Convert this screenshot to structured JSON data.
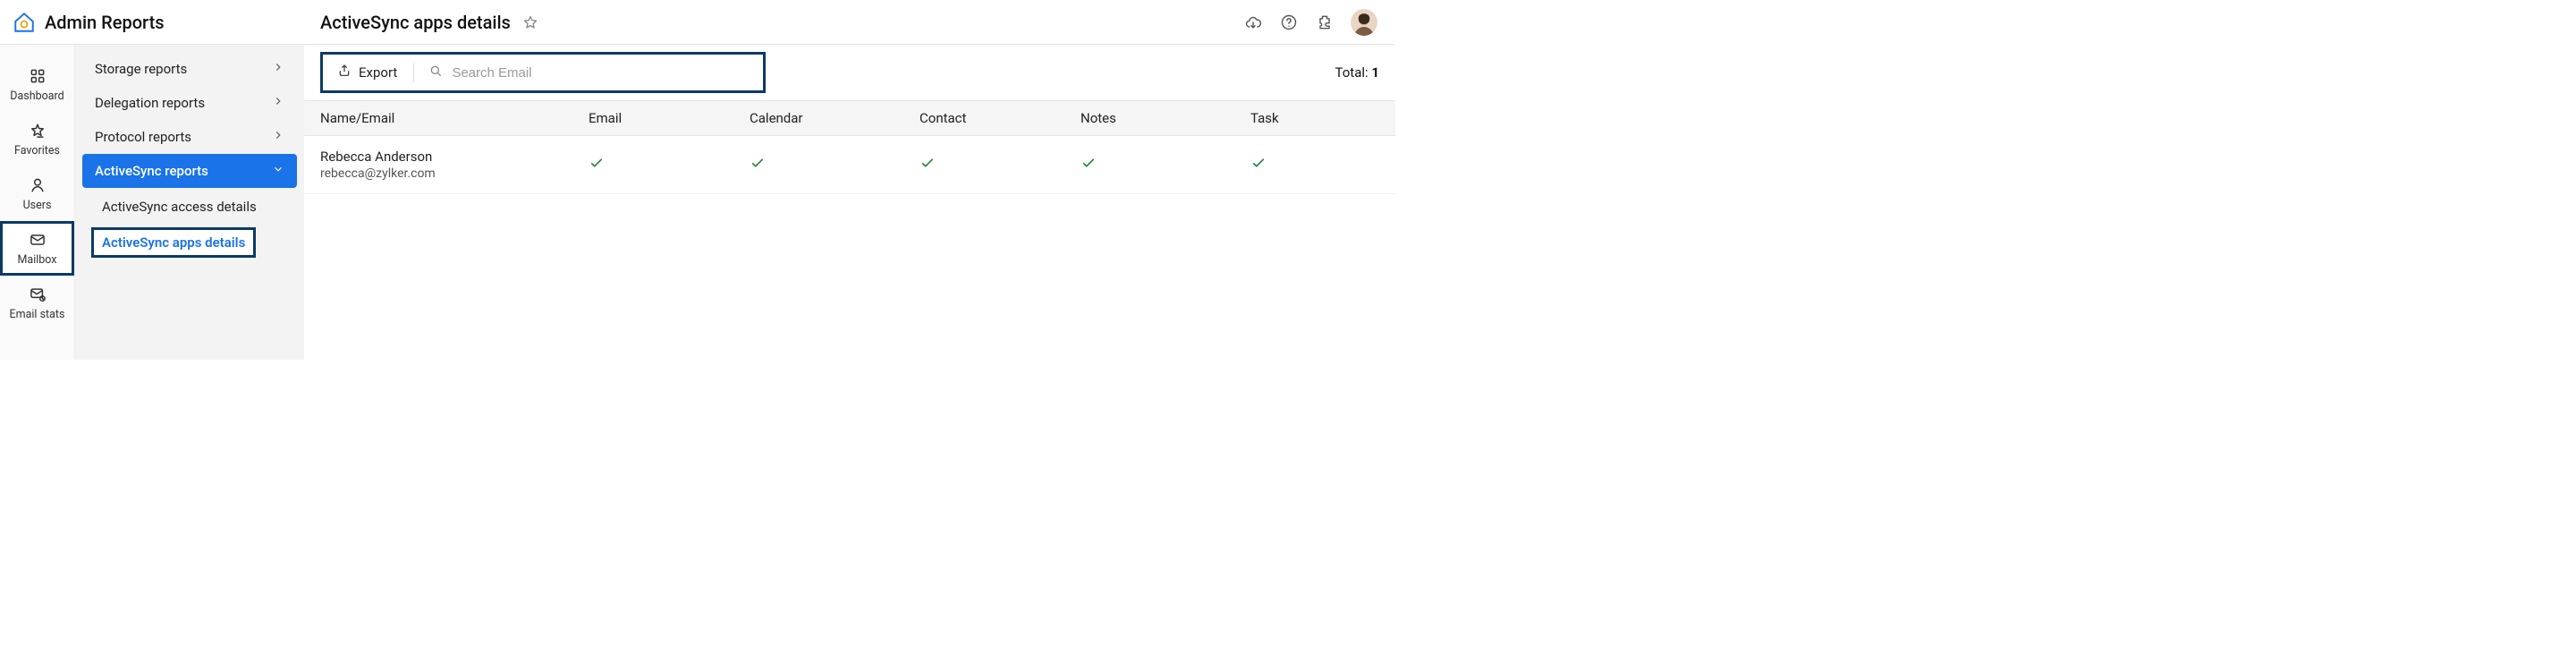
{
  "app": {
    "title": "Admin Reports"
  },
  "header": {
    "page_title": "ActiveSync apps details",
    "total_label": "Total:",
    "total_value": "1"
  },
  "toolbar": {
    "export_label": "Export",
    "search_placeholder": "Search Email"
  },
  "rail": {
    "items": [
      {
        "label": "Dashboard",
        "icon": "grid"
      },
      {
        "label": "Favorites",
        "icon": "star"
      },
      {
        "label": "Users",
        "icon": "user"
      },
      {
        "label": "Mailbox",
        "icon": "mail",
        "highlight": true
      },
      {
        "label": "Email stats",
        "icon": "mail-stats"
      }
    ]
  },
  "sidebar": {
    "groups": [
      {
        "label": "Storage reports"
      },
      {
        "label": "Delegation reports"
      },
      {
        "label": "Protocol reports"
      },
      {
        "label": "ActiveSync reports",
        "active": true,
        "children": [
          {
            "label": "ActiveSync access details"
          },
          {
            "label": "ActiveSync apps details",
            "selected": true
          }
        ]
      }
    ]
  },
  "table": {
    "columns": [
      "Name/Email",
      "Email",
      "Calendar",
      "Contact",
      "Notes",
      "Task"
    ],
    "rows": [
      {
        "name": "Rebecca Anderson",
        "email_addr": "rebecca@zylker.com",
        "Email": true,
        "Calendar": true,
        "Contact": true,
        "Notes": true,
        "Task": true
      }
    ]
  }
}
